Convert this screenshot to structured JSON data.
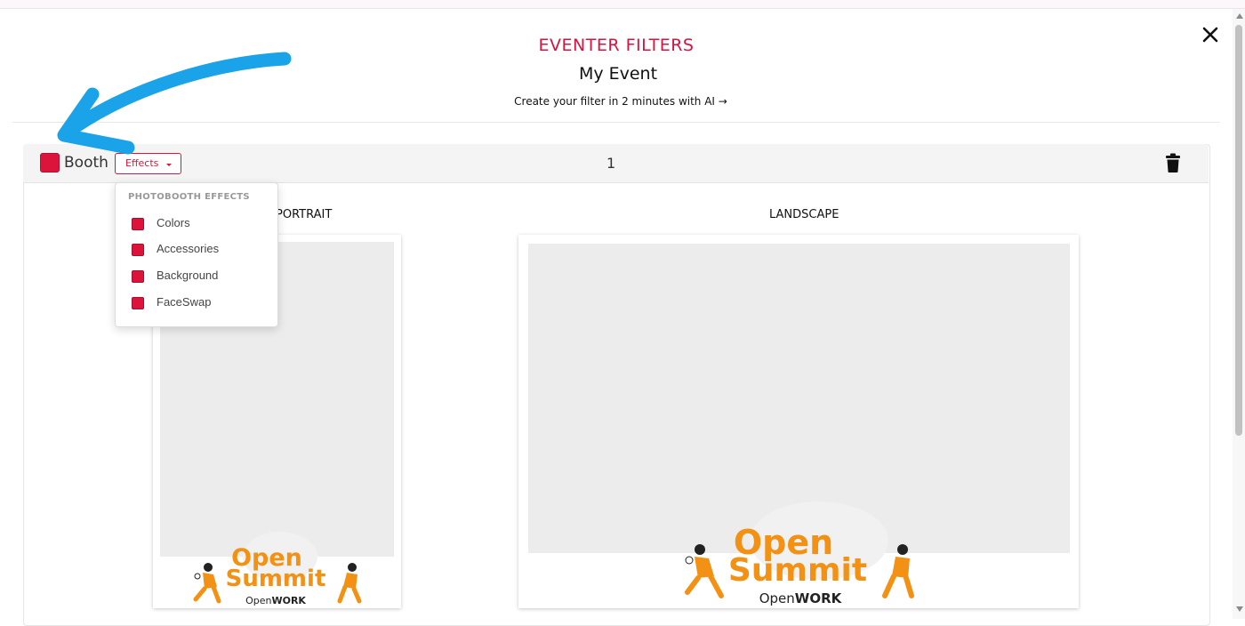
{
  "header": {
    "brand": "EVENTER FILTERS",
    "event_name": "My Event",
    "cta": "Create your filter in 2 minutes with AI →"
  },
  "toolbar": {
    "booth_label": "Booth",
    "booth_color": "#dc143c",
    "effects_label": "Effects",
    "counter": "1"
  },
  "dropdown": {
    "header": "PHOTOBOOTH EFFECTS",
    "items": [
      {
        "label": "Colors"
      },
      {
        "label": "Accessories"
      },
      {
        "label": "Background"
      },
      {
        "label": "FaceSwap"
      }
    ]
  },
  "sections": {
    "portrait_label": "PORTRAIT",
    "landscape_label": "LANDSCAPE"
  },
  "branding": {
    "logo_line1": "Open",
    "logo_line2": "Summit",
    "sub_prefix": "Open",
    "sub_suffix": "WORK"
  },
  "colors": {
    "accent": "#dc143c",
    "brand_orange": "#f29113",
    "annotation_arrow": "#1aa3e8"
  }
}
